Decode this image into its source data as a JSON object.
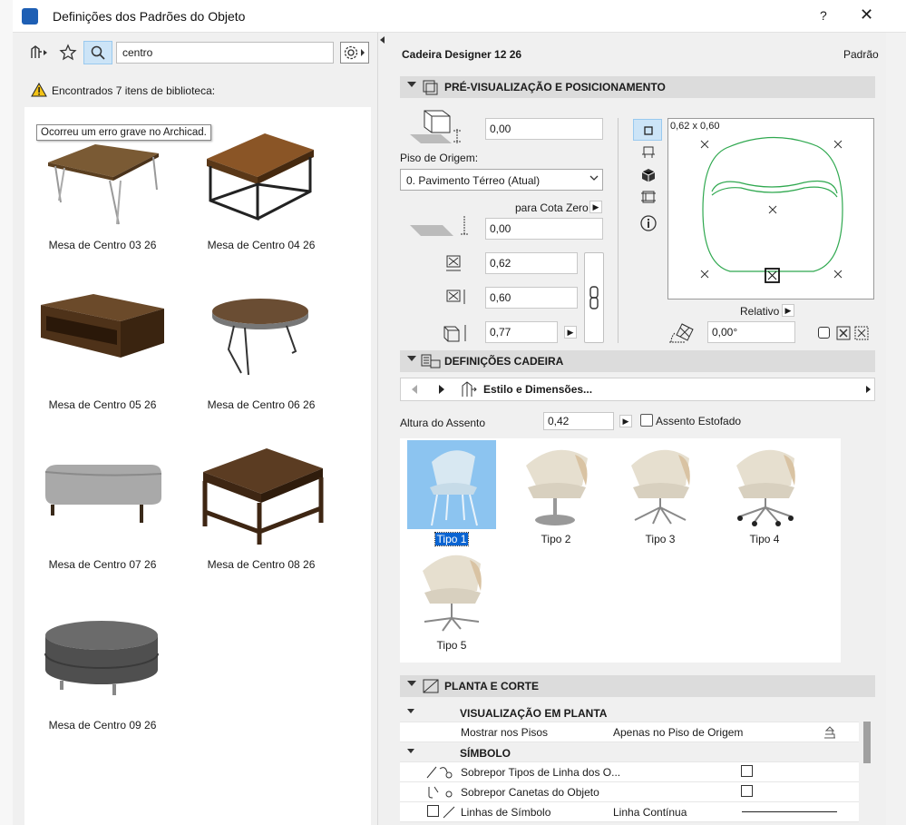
{
  "window": {
    "title": "Definições dos Padrões do Objeto",
    "help": "?",
    "close": "✕"
  },
  "left": {
    "search_value": "centro",
    "found_text": "Encontrados 7 itens de biblioteca:",
    "tooltip": "Ocorreu um erro grave no Archicad.",
    "items": [
      {
        "label": "Mesa de Centro 03 26"
      },
      {
        "label": "Mesa de Centro 04 26"
      },
      {
        "label": "Mesa de Centro 05 26"
      },
      {
        "label": "Mesa de Centro 06 26"
      },
      {
        "label": "Mesa de Centro 07 26"
      },
      {
        "label": "Mesa de Centro 08 26"
      },
      {
        "label": "Mesa de Centro 09 26"
      }
    ]
  },
  "right": {
    "object_name": "Cadeira Designer 12 26",
    "default_label": "Padrão",
    "preview_section": "PRÉ-VISUALIZAÇÃO E POSICIONAMENTO",
    "elevation_value": "0,00",
    "home_story_label": "Piso de Origem:",
    "home_story_value": "0. Pavimento Térreo (Atual)",
    "zero_label": "para Cota Zero",
    "zero_value": "0,00",
    "width_value": "0,62",
    "depth_value": "0,60",
    "height_value": "0,77",
    "preview_dims": "0,62 x 0,60",
    "relative_label": "Relativo",
    "angle_value": "0,00°",
    "chair_section": "DEFINIÇÕES CADEIRA",
    "style_page": "Estilo e Dimensões...",
    "seat_height_label": "Altura do Assento",
    "seat_height_value": "0,42",
    "upholstered_label": "Assento Estofado",
    "types": [
      {
        "label": "Tipo 1"
      },
      {
        "label": "Tipo 2"
      },
      {
        "label": "Tipo 3"
      },
      {
        "label": "Tipo 4"
      },
      {
        "label": "Tipo 5"
      }
    ],
    "plan_section": "PLANTA E CORTE",
    "table": {
      "group1": "VISUALIZAÇÃO EM PLANTA",
      "row1_name": "Mostrar nos Pisos",
      "row1_value": "Apenas no Piso de Origem",
      "group2": "SÍMBOLO",
      "row2_name": "Sobrepor Tipos de Linha dos O...",
      "row3_name": "Sobrepor Canetas do Objeto",
      "row4_name": "Linhas de Símbolo",
      "row4_value": "Linha Contínua"
    }
  },
  "colors": {
    "accent": "#1e5fb4",
    "selection": "#0a64d2",
    "outline": "#2fa84f"
  }
}
